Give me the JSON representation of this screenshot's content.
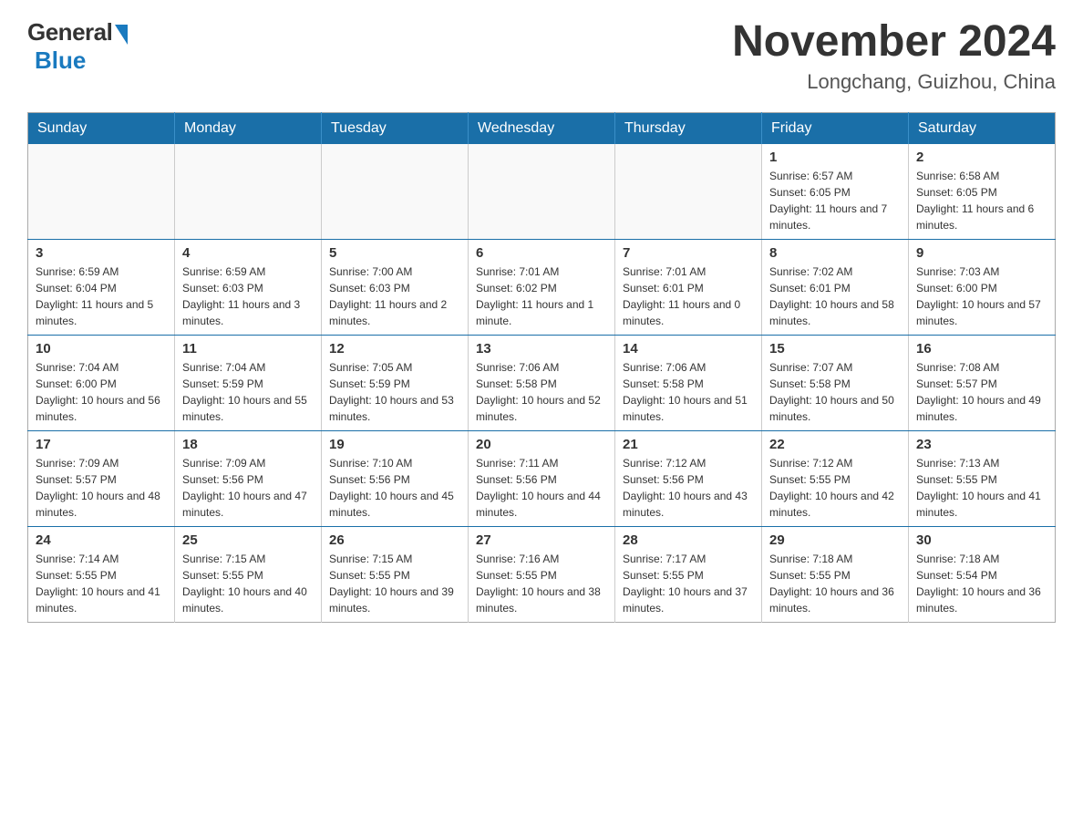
{
  "header": {
    "logo_general": "General",
    "logo_blue": "Blue",
    "month_title": "November 2024",
    "location": "Longchang, Guizhou, China"
  },
  "days_of_week": [
    "Sunday",
    "Monday",
    "Tuesday",
    "Wednesday",
    "Thursday",
    "Friday",
    "Saturday"
  ],
  "weeks": [
    [
      {
        "day": "",
        "info": ""
      },
      {
        "day": "",
        "info": ""
      },
      {
        "day": "",
        "info": ""
      },
      {
        "day": "",
        "info": ""
      },
      {
        "day": "",
        "info": ""
      },
      {
        "day": "1",
        "info": "Sunrise: 6:57 AM\nSunset: 6:05 PM\nDaylight: 11 hours and 7 minutes."
      },
      {
        "day": "2",
        "info": "Sunrise: 6:58 AM\nSunset: 6:05 PM\nDaylight: 11 hours and 6 minutes."
      }
    ],
    [
      {
        "day": "3",
        "info": "Sunrise: 6:59 AM\nSunset: 6:04 PM\nDaylight: 11 hours and 5 minutes."
      },
      {
        "day": "4",
        "info": "Sunrise: 6:59 AM\nSunset: 6:03 PM\nDaylight: 11 hours and 3 minutes."
      },
      {
        "day": "5",
        "info": "Sunrise: 7:00 AM\nSunset: 6:03 PM\nDaylight: 11 hours and 2 minutes."
      },
      {
        "day": "6",
        "info": "Sunrise: 7:01 AM\nSunset: 6:02 PM\nDaylight: 11 hours and 1 minute."
      },
      {
        "day": "7",
        "info": "Sunrise: 7:01 AM\nSunset: 6:01 PM\nDaylight: 11 hours and 0 minutes."
      },
      {
        "day": "8",
        "info": "Sunrise: 7:02 AM\nSunset: 6:01 PM\nDaylight: 10 hours and 58 minutes."
      },
      {
        "day": "9",
        "info": "Sunrise: 7:03 AM\nSunset: 6:00 PM\nDaylight: 10 hours and 57 minutes."
      }
    ],
    [
      {
        "day": "10",
        "info": "Sunrise: 7:04 AM\nSunset: 6:00 PM\nDaylight: 10 hours and 56 minutes."
      },
      {
        "day": "11",
        "info": "Sunrise: 7:04 AM\nSunset: 5:59 PM\nDaylight: 10 hours and 55 minutes."
      },
      {
        "day": "12",
        "info": "Sunrise: 7:05 AM\nSunset: 5:59 PM\nDaylight: 10 hours and 53 minutes."
      },
      {
        "day": "13",
        "info": "Sunrise: 7:06 AM\nSunset: 5:58 PM\nDaylight: 10 hours and 52 minutes."
      },
      {
        "day": "14",
        "info": "Sunrise: 7:06 AM\nSunset: 5:58 PM\nDaylight: 10 hours and 51 minutes."
      },
      {
        "day": "15",
        "info": "Sunrise: 7:07 AM\nSunset: 5:58 PM\nDaylight: 10 hours and 50 minutes."
      },
      {
        "day": "16",
        "info": "Sunrise: 7:08 AM\nSunset: 5:57 PM\nDaylight: 10 hours and 49 minutes."
      }
    ],
    [
      {
        "day": "17",
        "info": "Sunrise: 7:09 AM\nSunset: 5:57 PM\nDaylight: 10 hours and 48 minutes."
      },
      {
        "day": "18",
        "info": "Sunrise: 7:09 AM\nSunset: 5:56 PM\nDaylight: 10 hours and 47 minutes."
      },
      {
        "day": "19",
        "info": "Sunrise: 7:10 AM\nSunset: 5:56 PM\nDaylight: 10 hours and 45 minutes."
      },
      {
        "day": "20",
        "info": "Sunrise: 7:11 AM\nSunset: 5:56 PM\nDaylight: 10 hours and 44 minutes."
      },
      {
        "day": "21",
        "info": "Sunrise: 7:12 AM\nSunset: 5:56 PM\nDaylight: 10 hours and 43 minutes."
      },
      {
        "day": "22",
        "info": "Sunrise: 7:12 AM\nSunset: 5:55 PM\nDaylight: 10 hours and 42 minutes."
      },
      {
        "day": "23",
        "info": "Sunrise: 7:13 AM\nSunset: 5:55 PM\nDaylight: 10 hours and 41 minutes."
      }
    ],
    [
      {
        "day": "24",
        "info": "Sunrise: 7:14 AM\nSunset: 5:55 PM\nDaylight: 10 hours and 41 minutes."
      },
      {
        "day": "25",
        "info": "Sunrise: 7:15 AM\nSunset: 5:55 PM\nDaylight: 10 hours and 40 minutes."
      },
      {
        "day": "26",
        "info": "Sunrise: 7:15 AM\nSunset: 5:55 PM\nDaylight: 10 hours and 39 minutes."
      },
      {
        "day": "27",
        "info": "Sunrise: 7:16 AM\nSunset: 5:55 PM\nDaylight: 10 hours and 38 minutes."
      },
      {
        "day": "28",
        "info": "Sunrise: 7:17 AM\nSunset: 5:55 PM\nDaylight: 10 hours and 37 minutes."
      },
      {
        "day": "29",
        "info": "Sunrise: 7:18 AM\nSunset: 5:55 PM\nDaylight: 10 hours and 36 minutes."
      },
      {
        "day": "30",
        "info": "Sunrise: 7:18 AM\nSunset: 5:54 PM\nDaylight: 10 hours and 36 minutes."
      }
    ]
  ]
}
